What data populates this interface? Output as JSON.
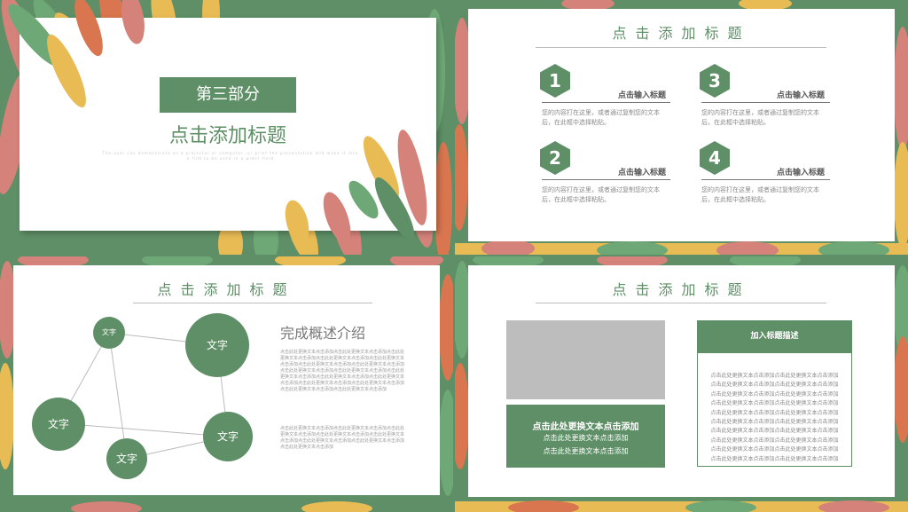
{
  "colors": {
    "accent": "#5e8f66",
    "gray_box": "#bdbdbd"
  },
  "slide1": {
    "label": "第三部分",
    "title": "点击添加标题",
    "subtitle": "The user can demonstrate on a projector or computer, or print the presentation and make it into a film to be used in a wider field"
  },
  "slide2": {
    "title": "点击添加标题",
    "items": [
      {
        "num": "1",
        "heading": "点击输入标题",
        "desc1": "您的内容打在这里，或者通过复制您的文本",
        "desc2": "后，在此框中选择粘贴。"
      },
      {
        "num": "3",
        "heading": "点击输入标题",
        "desc1": "您的内容打在这里，或者通过复制您的文本",
        "desc2": "后，在此框中选择粘贴。"
      },
      {
        "num": "2",
        "heading": "点击输入标题",
        "desc1": "您的内容打在这里，或者通过复制您的文本",
        "desc2": "后，在此框中选择粘贴。"
      },
      {
        "num": "4",
        "heading": "点击输入标题",
        "desc1": "您的内容打在这里，或者通过复制您的文本",
        "desc2": "后，在此框中选择粘贴。"
      }
    ]
  },
  "slide3": {
    "title": "点击添加标题",
    "nodes": [
      "文字",
      "文字",
      "文字",
      "文字",
      "文字"
    ],
    "heading": "完成概述介绍",
    "para1": "点击此处更换文本点击添加点击此处更换文本点击添加点击此处更换文本点击添加点击此处更换文本点击添加点击此处更换文本点击添加点击此处更换文本点击添加点击此处更换文本点击添加点击此处更换文本点击添加点击此处更换文本点击添加点击此处更换文本点击添加点击此处更换文本点击添加点击此处更换文本点击添加点击此处更换文本点击添加点击此处更换文本点击添加点击此处更换文本点击添加点击此处更换文本点击添加",
    "para2": "点击此处更换文本点击添加点击此处更换文本点击添加点击此处更换文本点击添加点击此处更换文本点击添加点击此处更换文本点击添加点击此处更换文本点击添加点击此处更换文本点击添加点击此处更换文本点击添加"
  },
  "slide4": {
    "title": "点击添加标题",
    "left_heading": "点击此处更换文本点击添加",
    "left_line1": "点击此处更换文本点击添加",
    "left_line2": "点击此处更换文本点击添加",
    "right_heading": "加入标题描述",
    "right_lines": [
      "点击此处更换文本点击添加点击此处更换文本点击添加",
      "点击此处更换文本点击添加点击此处更换文本点击添加",
      "点击此处更换文本点击添加点击此处更换文本点击添加",
      "点击此处更换文本点击添加点击此处更换文本点击添加",
      "点击此处更换文本点击添加点击此处更换文本点击添加",
      "点击此处更换文本点击添加点击此处更换文本点击添加",
      "点击此处更换文本点击添加点击此处更换文本点击添加",
      "点击此处更换文本点击添加点击此处更换文本点击添加",
      "点击此处更换文本点击添加点击此处更换文本点击添加",
      "点击此处更换文本点击添加点击此处更换文本点击添加"
    ]
  }
}
